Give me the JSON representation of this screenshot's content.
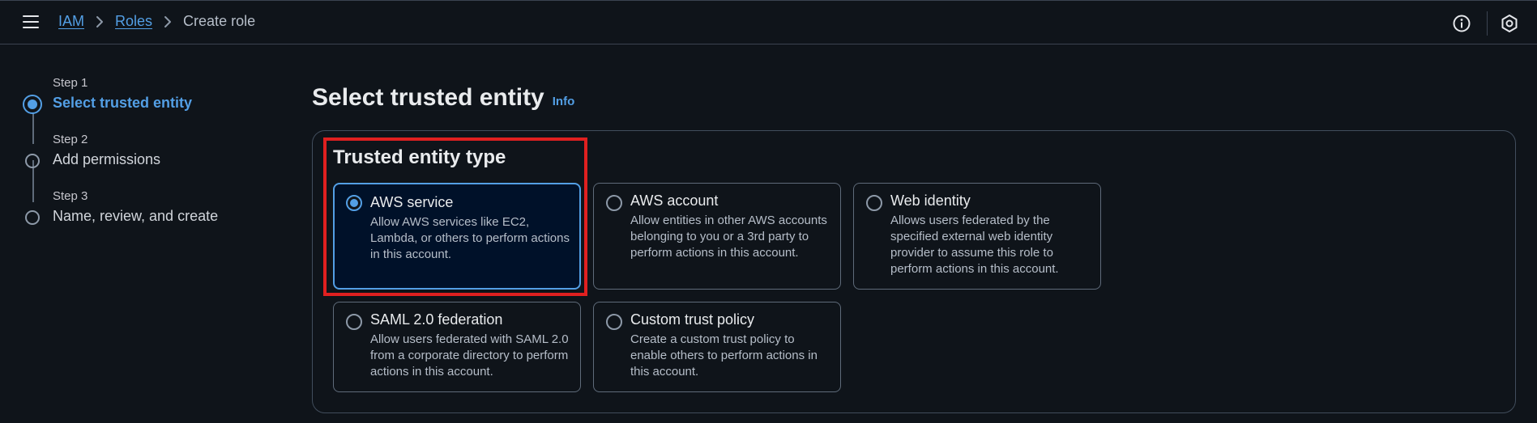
{
  "header": {
    "breadcrumb": [
      {
        "label": "IAM"
      },
      {
        "label": "Roles"
      },
      {
        "label": "Create role"
      }
    ]
  },
  "steps": [
    {
      "number": "Step 1",
      "title": "Select trusted entity",
      "state": "active"
    },
    {
      "number": "Step 2",
      "title": "Add permissions",
      "state": "inactive"
    },
    {
      "number": "Step 3",
      "title": "Name, review, and create",
      "state": "inactive"
    }
  ],
  "main": {
    "title": "Select trusted entity",
    "info_label": "Info",
    "section_title": "Trusted entity type",
    "options": [
      {
        "title": "AWS service",
        "description": "Allow AWS services like EC2, Lambda, or others to perform actions in this account.",
        "selected": true
      },
      {
        "title": "AWS account",
        "description": "Allow entities in other AWS accounts belonging to you or a 3rd party to perform actions in this account.",
        "selected": false
      },
      {
        "title": "Web identity",
        "description": "Allows users federated by the specified external web identity provider to assume this role to perform actions in this account.",
        "selected": false
      },
      {
        "title": "SAML 2.0 federation",
        "description": "Allow users federated with SAML 2.0 from a corporate directory to perform actions in this account.",
        "selected": false
      },
      {
        "title": "Custom trust policy",
        "description": "Create a custom trust policy to enable others to perform actions in this account.",
        "selected": false
      }
    ]
  },
  "colors": {
    "accent": "#539fe5",
    "highlight": "#e02020",
    "background": "#0f141a"
  },
  "icons": {
    "menu": "hamburger-menu-icon",
    "info": "info-circle-icon",
    "settings": "settings-hexagon-icon"
  }
}
